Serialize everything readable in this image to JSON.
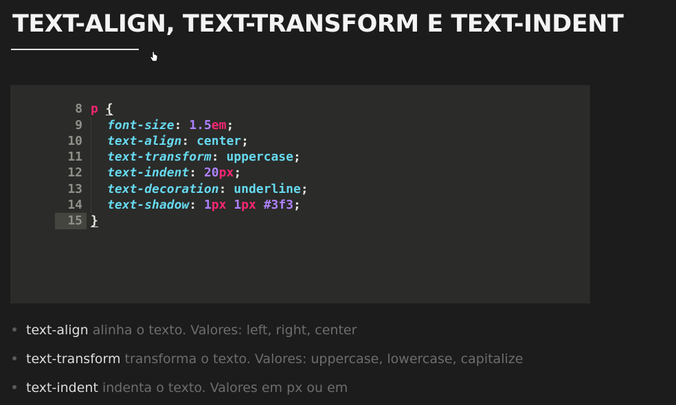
{
  "slide": {
    "title": "TEXT-ALIGN, TEXT-TRANSFORM E TEXT-INDENT"
  },
  "code": {
    "lines": [
      {
        "num": "8",
        "selector": "p",
        "open": "{"
      },
      {
        "num": "9",
        "prop": "font-size",
        "value_num": "1.5",
        "value_unit": "em"
      },
      {
        "num": "10",
        "prop": "text-align",
        "value_kw": "center"
      },
      {
        "num": "11",
        "prop": "text-transform",
        "value_kw": "uppercase"
      },
      {
        "num": "12",
        "prop": "text-indent",
        "value_num": "20",
        "value_unit": "px"
      },
      {
        "num": "13",
        "prop": "text-decoration",
        "value_kw": "underline"
      },
      {
        "num": "14",
        "prop": "text-shadow",
        "v1_num": "1",
        "v1_unit": "px",
        "v2_num": "1",
        "v2_unit": "px",
        "v3_color": "#3f3"
      },
      {
        "num": "15",
        "close": "}"
      }
    ]
  },
  "bullets": [
    {
      "term": "text-align",
      "desc": " alinha o texto. Valores: left, right, center"
    },
    {
      "term": "text-transform",
      "desc": " transforma o texto. Valores: uppercase, lowercase, capitalize"
    },
    {
      "term": "text-indent",
      "desc": " indenta o texto. Valores em px ou em"
    }
  ],
  "icons": {
    "cursor": "hand-pointer-icon"
  },
  "colors": {
    "background": "#1c1c1c",
    "code_background": "#2b2b29",
    "selector": "#f92672",
    "property": "#66d9ef",
    "number": "#ae81ff"
  }
}
